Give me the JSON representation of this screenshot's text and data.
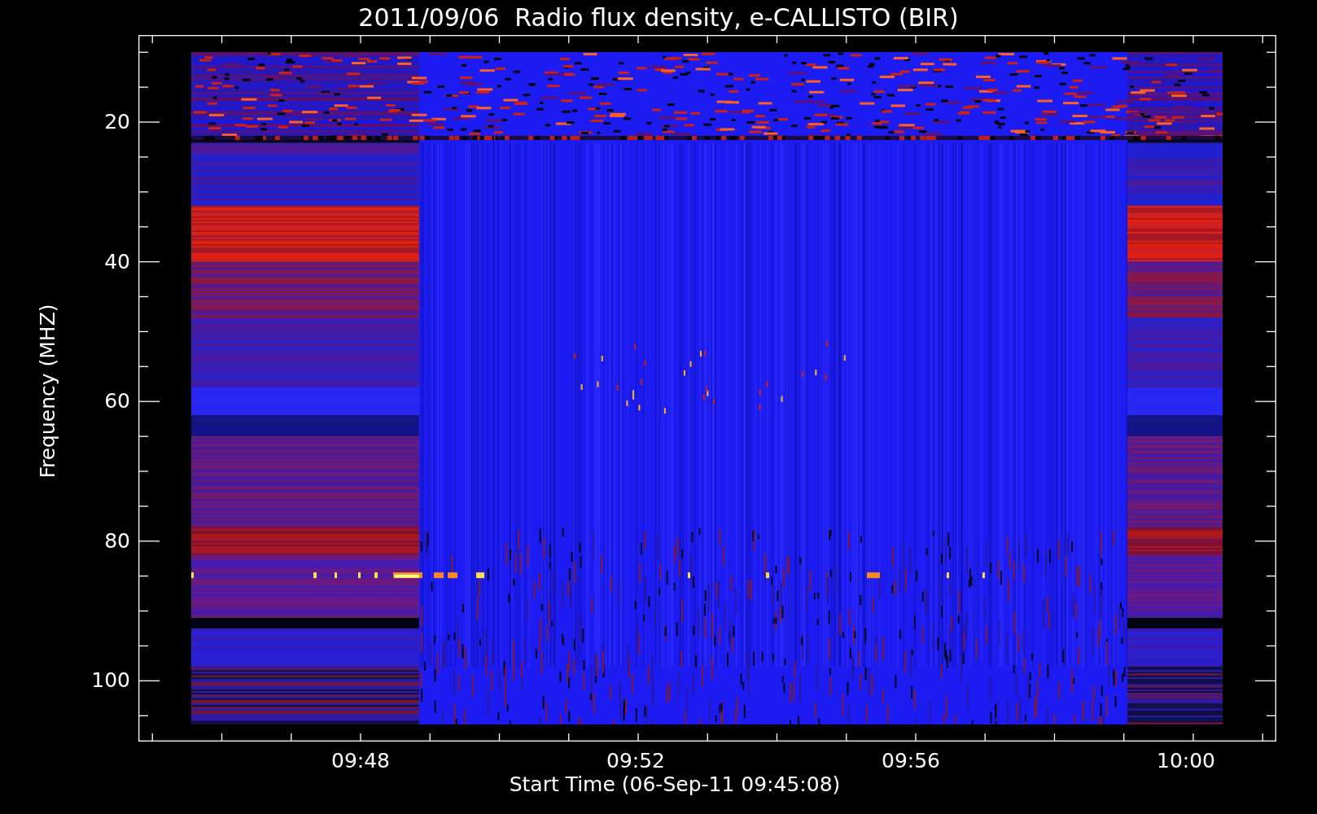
{
  "title": "2011/09/06  Radio flux density, e-CALLISTO (BIR)",
  "y_axis": {
    "label": "Frequency (MHZ)",
    "ticks": [
      "20",
      "40",
      "60",
      "80",
      "100"
    ]
  },
  "x_axis": {
    "label": "Start Time (06-Sep-11 09:45:08)",
    "ticks": [
      "09:48",
      "09:52",
      "09:56",
      "10:00"
    ]
  }
}
